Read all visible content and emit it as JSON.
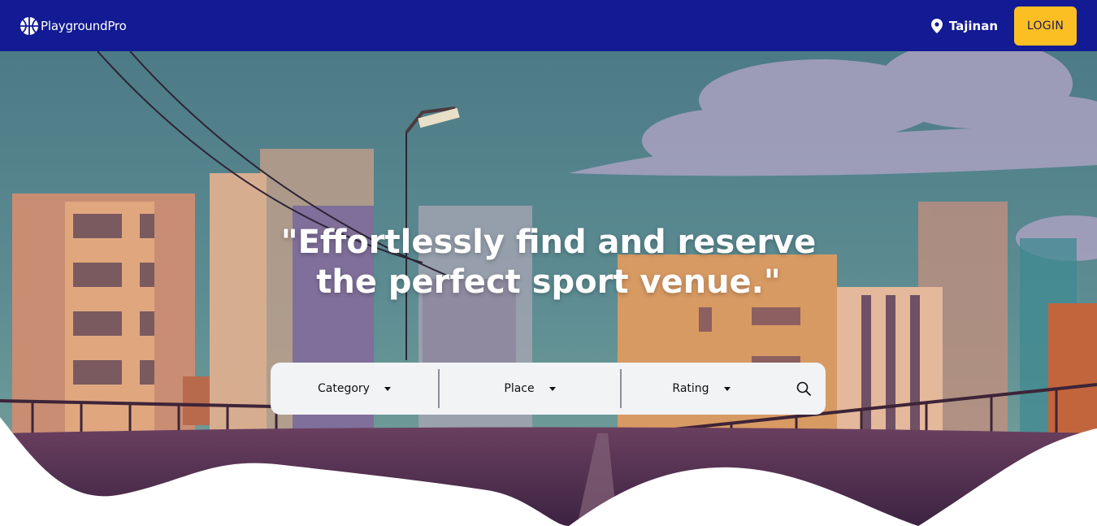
{
  "header": {
    "brand_name": "PlaygroundPro",
    "location": "Tajinan",
    "login_label": "LOGIN",
    "colors": {
      "nav_bg": "#121a94",
      "login_bg": "#fbbf24"
    }
  },
  "hero": {
    "title_line_1": "\"Effortlessly find and reserve",
    "title_line_2": "the perfect sport venue.\""
  },
  "search": {
    "filters": [
      {
        "label": "Category",
        "icon": "chevron-down-icon"
      },
      {
        "label": "Place",
        "icon": "chevron-down-icon"
      },
      {
        "label": "Rating",
        "icon": "chevron-down-icon"
      }
    ],
    "search_icon": "search-icon"
  },
  "icons": {
    "brand": "basketball-logo-icon",
    "location": "map-pin-icon"
  }
}
